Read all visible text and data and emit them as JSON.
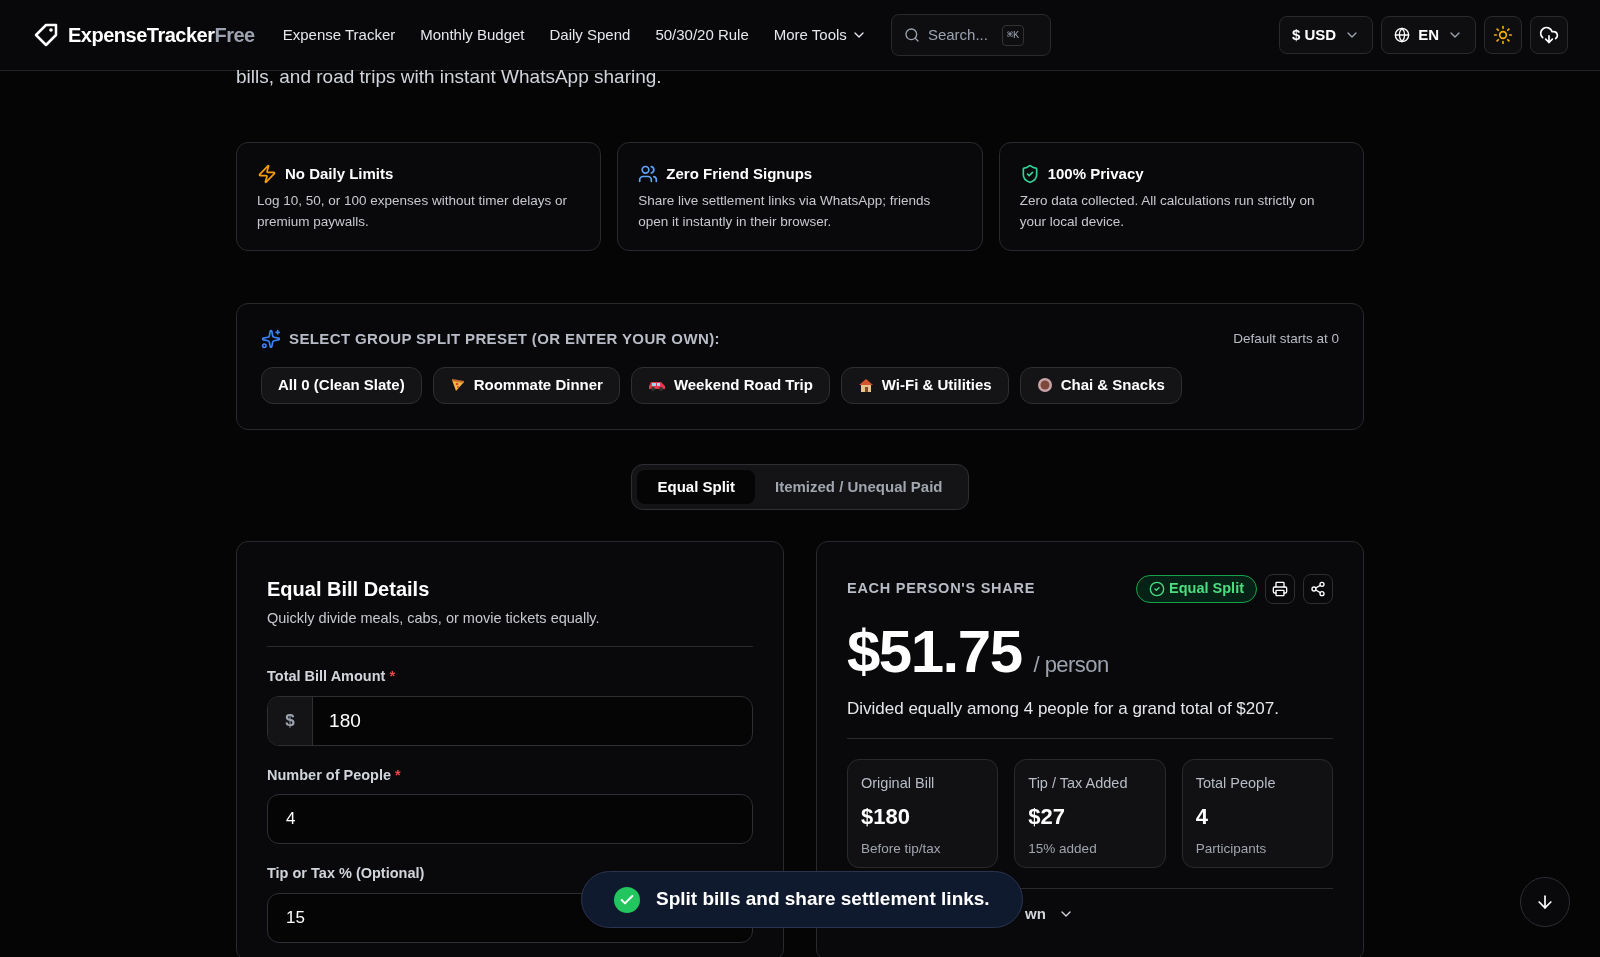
{
  "header": {
    "brand": {
      "main": "ExpenseTracker",
      "accent": "Free"
    },
    "nav": [
      {
        "label": "Expense Tracker"
      },
      {
        "label": "Monthly Budget"
      },
      {
        "label": "Daily Spend"
      },
      {
        "label": "50/30/20 Rule"
      },
      {
        "label": "More Tools",
        "dropdown": true
      }
    ],
    "search": {
      "placeholder": "Search...",
      "shortcut": "⌘K"
    },
    "currency_symbol": "$",
    "currency": "USD",
    "language": "EN"
  },
  "intro": "bills, and road trips with instant WhatsApp sharing.",
  "features": [
    {
      "kind": "bolt",
      "title": "No Daily Limits",
      "text": "Log 10, 50, or 100 expenses without timer delays or premium paywalls."
    },
    {
      "kind": "users",
      "title": "Zero Friend Signups",
      "text": "Share live settlement links via WhatsApp; friends open it instantly in their browser."
    },
    {
      "kind": "shield",
      "title": "100% Privacy",
      "text": "Zero data collected. All calculations run strictly on your local device."
    }
  ],
  "presets": {
    "title": "SELECT GROUP SPLIT PRESET (OR ENTER YOUR OWN):",
    "note": "Default starts at 0",
    "items": [
      {
        "label": "All 0 (Clean Slate)",
        "kind": "plain"
      },
      {
        "label": "Roommate Dinner",
        "kind": "pizza"
      },
      {
        "label": "Weekend Road Trip",
        "kind": "car"
      },
      {
        "label": "Wi-Fi & Utilities",
        "kind": "house"
      },
      {
        "label": "Chai & Snacks",
        "kind": "cup"
      }
    ]
  },
  "mode_tabs": [
    {
      "label": "Equal Split",
      "selected": true
    },
    {
      "label": "Itemized / Unequal Paid",
      "selected": false
    }
  ],
  "details": {
    "title": "Equal Bill Details",
    "subtitle": "Quickly divide meals, cabs, or movie tickets equally.",
    "fields": [
      {
        "label": "Total Bill Amount",
        "required_mark": "*",
        "prefix": "$",
        "value": "180"
      },
      {
        "label": "Number of People",
        "required_mark": "*",
        "value": "4"
      },
      {
        "label": "Tip or Tax % (Optional)",
        "value": "15"
      }
    ]
  },
  "result": {
    "title": "EACH PERSON'S SHARE",
    "badge": "Equal Split",
    "amount": "$51.75",
    "unit": "/ person",
    "summary": "Divided equally among 4 people for a grand total of $207.",
    "stats": [
      {
        "label": "Original Bill",
        "value": "$180",
        "note": "Before tip/tax"
      },
      {
        "label": "Tip / Tax Added",
        "value": "$27",
        "note": "15% added"
      },
      {
        "label": "Total People",
        "value": "4",
        "note": "Participants"
      }
    ],
    "breakdown_toggle": "wn"
  },
  "toast": "Split bills and share settlement links."
}
